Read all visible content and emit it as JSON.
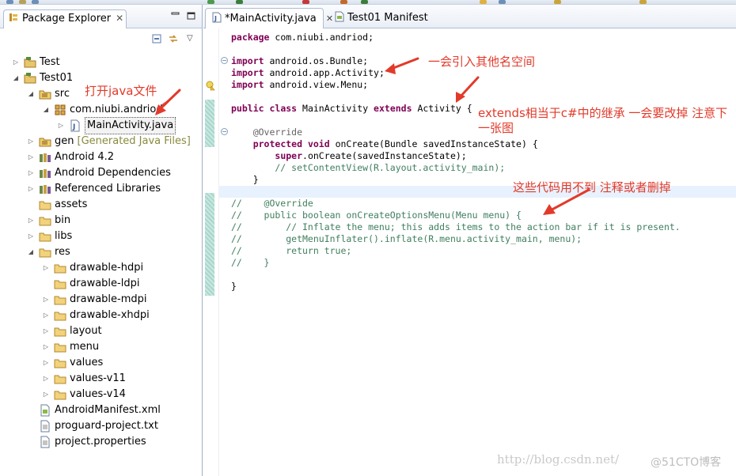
{
  "explorer": {
    "tab_title": "Package Explorer",
    "close_glyph": "✕",
    "tree": [
      {
        "label": "Test",
        "icon": "project-icon",
        "level": 0,
        "expanded": false
      },
      {
        "label": "Test01",
        "icon": "project-icon",
        "level": 0,
        "expanded": true
      },
      {
        "label": "src",
        "icon": "source-folder-icon",
        "level": 1,
        "expanded": true
      },
      {
        "label": "com.niubi.andriod",
        "icon": "package-icon",
        "level": 2,
        "expanded": true
      },
      {
        "label": "MainActivity.java",
        "icon": "java-file-icon",
        "level": 3,
        "expanded": false,
        "selected": true
      },
      {
        "label": "gen",
        "icon": "source-folder-icon",
        "level": 1,
        "expanded": false,
        "suffix": "[Generated Java Files]"
      },
      {
        "label": "Android 4.2",
        "icon": "library-icon",
        "level": 1,
        "expanded": false
      },
      {
        "label": "Android Dependencies",
        "icon": "library-icon",
        "level": 1,
        "expanded": false
      },
      {
        "label": "Referenced Libraries",
        "icon": "library-icon",
        "level": 1,
        "expanded": false
      },
      {
        "label": "assets",
        "icon": "folder-icon",
        "level": 1,
        "leaf": true
      },
      {
        "label": "bin",
        "icon": "folder-icon",
        "level": 1,
        "expanded": false
      },
      {
        "label": "libs",
        "icon": "folder-icon",
        "level": 1,
        "expanded": false
      },
      {
        "label": "res",
        "icon": "folder-icon",
        "level": 1,
        "expanded": true
      },
      {
        "label": "drawable-hdpi",
        "icon": "folder-icon",
        "level": 2,
        "expanded": false
      },
      {
        "label": "drawable-ldpi",
        "icon": "folder-icon",
        "level": 2,
        "leaf": true
      },
      {
        "label": "drawable-mdpi",
        "icon": "folder-icon",
        "level": 2,
        "expanded": false
      },
      {
        "label": "drawable-xhdpi",
        "icon": "folder-icon",
        "level": 2,
        "expanded": false
      },
      {
        "label": "layout",
        "icon": "folder-icon",
        "level": 2,
        "expanded": false
      },
      {
        "label": "menu",
        "icon": "folder-icon",
        "level": 2,
        "expanded": false
      },
      {
        "label": "values",
        "icon": "folder-icon",
        "level": 2,
        "expanded": false
      },
      {
        "label": "values-v11",
        "icon": "folder-icon",
        "level": 2,
        "expanded": false
      },
      {
        "label": "values-v14",
        "icon": "folder-icon",
        "level": 2,
        "expanded": false
      },
      {
        "label": "AndroidManifest.xml",
        "icon": "xml-file-icon",
        "level": 1,
        "leaf": true
      },
      {
        "label": "proguard-project.txt",
        "icon": "text-file-icon",
        "level": 1,
        "leaf": true
      },
      {
        "label": "project.properties",
        "icon": "text-file-icon",
        "level": 1,
        "leaf": true
      }
    ]
  },
  "editor": {
    "tabs": [
      {
        "label": "*MainActivity.java",
        "active": true,
        "icon": "java-file-icon"
      },
      {
        "label": "Test01 Manifest",
        "active": false,
        "icon": "manifest-icon"
      }
    ],
    "close_glyph": "✕",
    "lines": [
      [
        {
          "t": "package",
          "c": "kw"
        },
        {
          "t": " com.niubi.andriod;",
          "c": ""
        }
      ],
      [],
      [
        {
          "t": "import",
          "c": "kw"
        },
        {
          "t": " android.os.Bundle;",
          "c": ""
        }
      ],
      [
        {
          "t": "import",
          "c": "kw"
        },
        {
          "t": " android.app.Activity;",
          "c": ""
        }
      ],
      [
        {
          "t": "import",
          "c": "kw"
        },
        {
          "t": " android.view.Menu;",
          "c": ""
        }
      ],
      [],
      [
        {
          "t": "public",
          "c": "kw"
        },
        {
          "t": " ",
          "c": ""
        },
        {
          "t": "class",
          "c": "kw"
        },
        {
          "t": " MainActivity ",
          "c": ""
        },
        {
          "t": "extends",
          "c": "kw"
        },
        {
          "t": " Activity {",
          "c": ""
        }
      ],
      [],
      [
        {
          "t": "    @Override",
          "c": "ann"
        }
      ],
      [
        {
          "t": "    ",
          "c": ""
        },
        {
          "t": "protected",
          "c": "kw"
        },
        {
          "t": " ",
          "c": ""
        },
        {
          "t": "void",
          "c": "kw"
        },
        {
          "t": " onCreate(Bundle savedInstanceState) {",
          "c": ""
        }
      ],
      [
        {
          "t": "        ",
          "c": ""
        },
        {
          "t": "super",
          "c": "kw"
        },
        {
          "t": ".onCreate(savedInstanceState);",
          "c": ""
        }
      ],
      [
        {
          "t": "        // setContentView(R.layout.activity_main);",
          "c": "cm"
        }
      ],
      [
        {
          "t": "    }",
          "c": ""
        }
      ],
      [],
      [
        {
          "t": "//    @Override",
          "c": "cm"
        }
      ],
      [
        {
          "t": "//    public boolean onCreateOptionsMenu(Menu menu) {",
          "c": "cm"
        }
      ],
      [
        {
          "t": "//        // Inflate the menu; this adds items to the action bar if it is present.",
          "c": "cm"
        }
      ],
      [
        {
          "t": "//        getMenuInflater().inflate(R.menu.activity_main, menu);",
          "c": "cm"
        }
      ],
      [
        {
          "t": "//        return true;",
          "c": "cm"
        }
      ],
      [
        {
          "t": "//    }",
          "c": "cm"
        }
      ],
      [],
      [
        {
          "t": "}",
          "c": ""
        }
      ]
    ]
  },
  "annotations": {
    "open_java_file": "打开java文件",
    "import_other_namespaces": "一会引入其他名空间",
    "extends_line1": "extends相当于c#中的继承 一会要改掉 注意下",
    "extends_line2": "一张图",
    "unused_code": "这些代码用不到 注释或者删掉",
    "color": "#e23a2a"
  },
  "watermark": {
    "url_text": "http://blog.csdn.net/",
    "brand_text": "@51CTO博客"
  }
}
